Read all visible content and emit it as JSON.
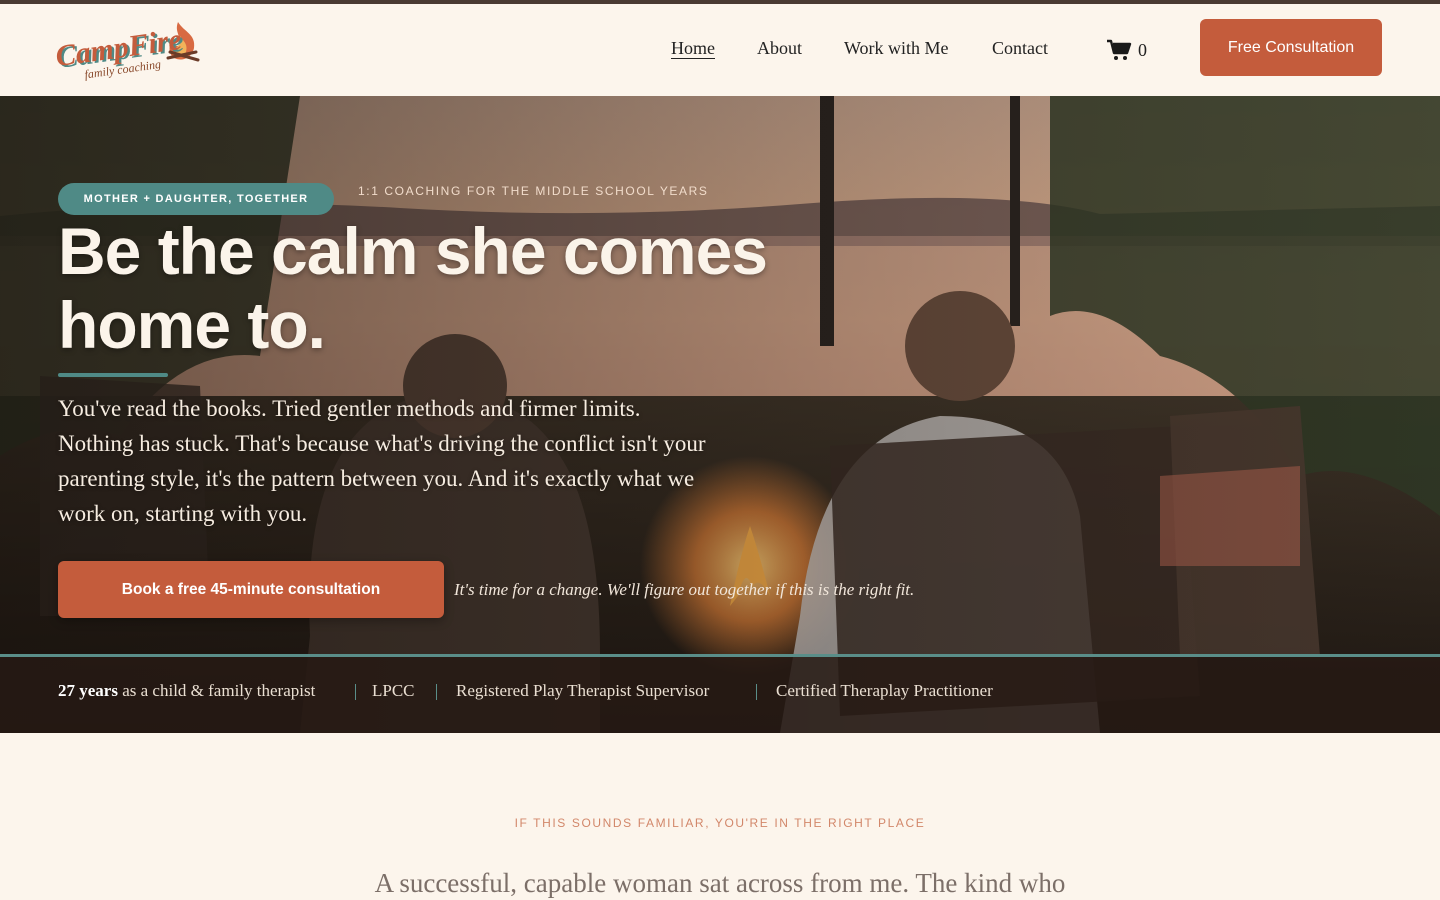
{
  "brand": {
    "logo_word": "CampFire",
    "logo_sub": "family coaching",
    "colors": {
      "accent": "#c45c3c",
      "teal": "#4f8a86",
      "cream": "#fcf5ec",
      "dark": "#2a1f1a"
    }
  },
  "nav": {
    "items": [
      {
        "label": "Home",
        "active": true
      },
      {
        "label": "About"
      },
      {
        "label": "Work with Me"
      },
      {
        "label": "Contact"
      }
    ],
    "cart_icon": "cart-icon",
    "cart_count": "0",
    "cta": "Free Consultation"
  },
  "hero": {
    "pill": "MOTHER + DAUGHTER, TOGETHER",
    "eyebrow": "1:1 COACHING FOR THE MIDDLE SCHOOL YEARS",
    "headline": "Be the calm she comes home to.",
    "lede": "You've read the books. Tried gentler methods and firmer limits. Nothing has stuck. That's because what's driving the conflict isn't your parenting style, it's the pattern between you. And it's exactly what we work on, starting with you.",
    "cta": "Book a free 45-minute consultation",
    "cta_note": "It's time for a change. We'll figure out together if this is the right fit."
  },
  "credentials": {
    "years_bold": "27 years",
    "years_rest": " as a child & family therapist",
    "items": [
      "LPCC",
      "Registered Play Therapist Supervisor",
      "Certified Theraplay Practitioner"
    ]
  },
  "section": {
    "eyebrow": "IF THIS SOUNDS FAMILIAR, YOU'RE IN THE RIGHT PLACE",
    "text": "A successful, capable woman sat across from me. The kind who"
  }
}
